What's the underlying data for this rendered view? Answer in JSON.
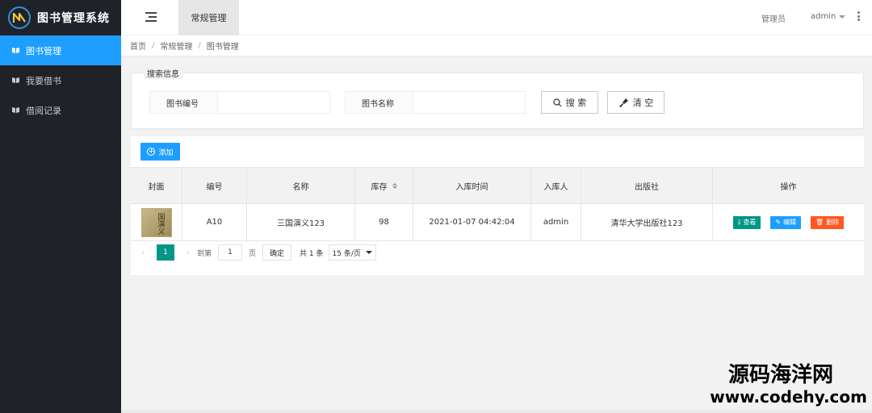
{
  "app": {
    "title": "图书管理系统"
  },
  "sidebar": {
    "items": [
      {
        "label": "图书管理",
        "active": true
      },
      {
        "label": "我要借书",
        "active": false
      },
      {
        "label": "借阅记录",
        "active": false
      }
    ]
  },
  "header": {
    "tab": "常规管理",
    "role": "管理员",
    "user": "admin"
  },
  "breadcrumb": [
    "首页",
    "常规管理",
    "图书管理"
  ],
  "search": {
    "legend": "搜索信息",
    "fields": [
      {
        "label": "图书编号",
        "value": ""
      },
      {
        "label": "图书名称",
        "value": ""
      }
    ],
    "search_label": "搜 索",
    "clear_label": "清 空"
  },
  "toolbar": {
    "add_label": "添加"
  },
  "table": {
    "columns": [
      "封面",
      "编号",
      "名称",
      "库存",
      "入库时间",
      "入库人",
      "出版社",
      "操作"
    ],
    "rows": [
      {
        "cover_text": "国演义",
        "id": "A10",
        "name": "三国演义123",
        "stock": "98",
        "time": "2021-01-07 04:42:04",
        "operator": "admin",
        "publisher": "清华大学出版社123"
      }
    ],
    "actions": {
      "view": "查看",
      "edit": "编辑",
      "delete": "删除"
    }
  },
  "pager": {
    "prev": "‹",
    "next": "›",
    "current": "1",
    "goto_prefix": "到第",
    "goto_value": "1",
    "goto_suffix": "页",
    "confirm": "确定",
    "total": "共 1 条",
    "page_size": "15 条/页"
  },
  "watermark": {
    "title": "源码海洋网",
    "url": "www.codehy.com"
  },
  "colors": {
    "sidebar_bg": "#20222a",
    "accent": "#1e9fff",
    "view": "#009688",
    "delete": "#ff5722"
  }
}
